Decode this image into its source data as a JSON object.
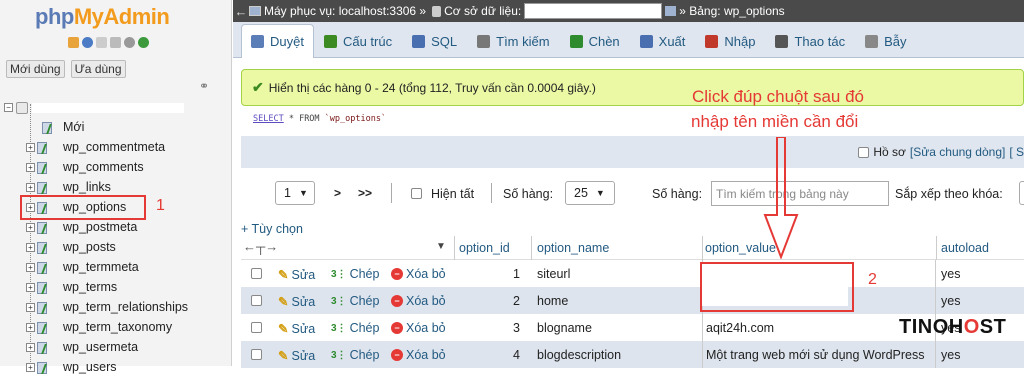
{
  "sidebar": {
    "logo_php": "php",
    "logo_admin": "MyAdmin",
    "tab_recent": "Mới dùng",
    "tab_favorites": "Ưa dùng",
    "new_label": "Mới",
    "tables": [
      "wp_commentmeta",
      "wp_comments",
      "wp_links",
      "wp_options",
      "wp_postmeta",
      "wp_posts",
      "wp_termmeta",
      "wp_terms",
      "wp_term_relationships",
      "wp_term_taxonomy",
      "wp_usermeta",
      "wp_users"
    ]
  },
  "breadcrumb": {
    "server": "Máy phục vụ: localhost:3306 »",
    "database": "Cơ sở dữ liệu:",
    "table": "» Bảng: wp_options"
  },
  "tabs": [
    "Duyệt",
    "Cấu trúc",
    "SQL",
    "Tìm kiếm",
    "Chèn",
    "Xuất",
    "Nhập",
    "Thao tác",
    "Bẫy"
  ],
  "tab_colors": [
    "#5b7db8",
    "#3c8a22",
    "#4a6fb0",
    "#777777",
    "#2e8b2e",
    "#4a6fb0",
    "#c0392b",
    "#555555",
    "#888888"
  ],
  "success_message": "Hiển thị các hàng 0 - 24 (tổng 112, Truy vấn cần 0.0004 giây.)",
  "sql": {
    "select": "SELECT",
    "rest": " * FROM ",
    "table": "`wp_options`"
  },
  "profiling": {
    "label": "Hồ sơ",
    "edit_inline": "[Sửa chung dòng]",
    "bracket": "[ S"
  },
  "navigation": {
    "page": "1",
    "next": ">",
    "last": ">>",
    "show_all": "Hiện tất",
    "rows_label": "Số hàng:",
    "rows_value": "25",
    "filter_label": "Số hàng:",
    "filter_placeholder": "Tìm kiếm trong bảng này",
    "sort_label": "Sắp xếp theo khóa:"
  },
  "options_link": "+ Tùy chọn",
  "columns": [
    "option_id",
    "option_name",
    "option_value",
    "autoload"
  ],
  "row_actions": {
    "edit": "Sửa",
    "copy": "Chép",
    "delete": "Xóa bỏ"
  },
  "rows": [
    {
      "id": "1",
      "name": "siteurl",
      "value": "",
      "autoload": "yes"
    },
    {
      "id": "2",
      "name": "home",
      "value": "",
      "autoload": "yes"
    },
    {
      "id": "3",
      "name": "blogname",
      "value": "aqit24h.com",
      "autoload": "yes"
    },
    {
      "id": "4",
      "name": "blogdescription",
      "value": "Một trang web mới sử dụng WordPress",
      "autoload": "yes"
    }
  ],
  "annotations": {
    "instruction_line1": "Click đúp chuột sau đó",
    "instruction_line2": "nhập tên miền cần đổi",
    "step1": "1",
    "step2": "2"
  },
  "watermark": {
    "part1": "TINO",
    "part2": "H",
    "part3": "O",
    "part4": "ST"
  }
}
